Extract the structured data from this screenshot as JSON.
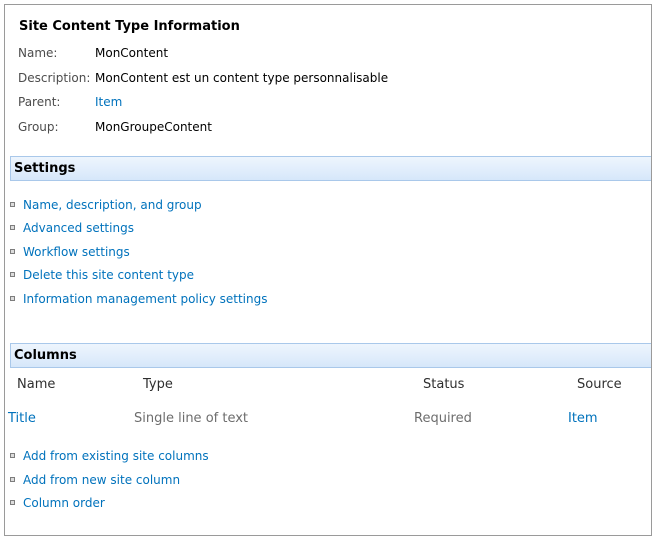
{
  "info": {
    "title": "Site Content Type Information",
    "rows": [
      {
        "label": "Name:",
        "value": "MonContent"
      },
      {
        "label": "Description:",
        "value": "MonContent est un content type personnalisable"
      },
      {
        "label": "Parent:",
        "value": "Item"
      },
      {
        "label": "Group:",
        "value": "MonGroupeContent"
      }
    ]
  },
  "settings": {
    "title": "Settings",
    "links": [
      "Name, description, and group",
      "Advanced settings",
      "Workflow settings",
      "Delete this site content type",
      "Information management policy settings"
    ]
  },
  "columns": {
    "title": "Columns",
    "headers": [
      "Name",
      "Type",
      "Status",
      "Source"
    ],
    "rows": [
      {
        "name": "Title",
        "type": "Single line of text",
        "status": "Required",
        "source": "Item"
      }
    ],
    "links": [
      "Add from existing site columns",
      "Add from new site column",
      "Column order"
    ]
  },
  "colors": {
    "link": "#0072bc",
    "section_border": "#a9c8ea",
    "section_bg": "#d6e7fa"
  }
}
